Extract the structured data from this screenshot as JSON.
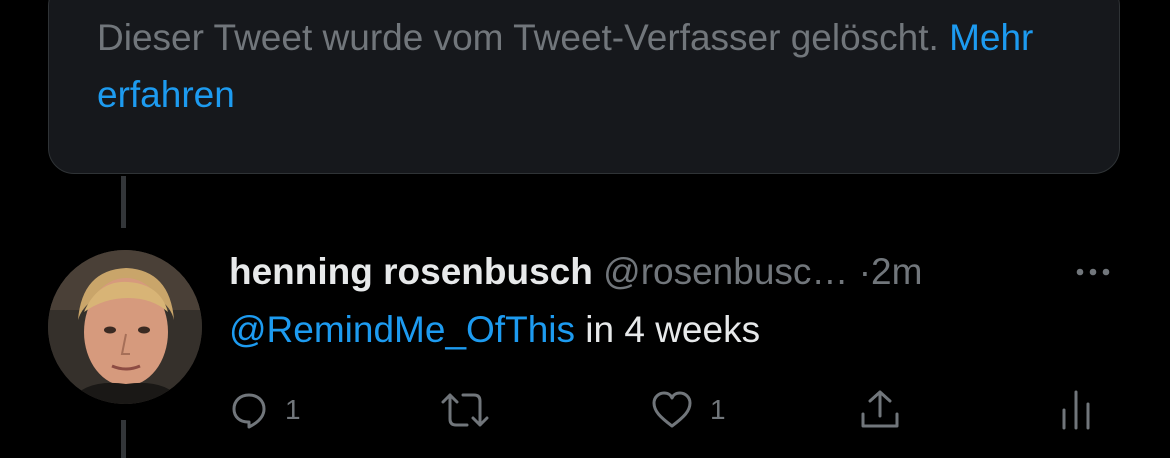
{
  "deleted_tweet": {
    "text": "Dieser Tweet wurde vom Tweet-Verfasser gelöscht.",
    "link": "Mehr erfahren"
  },
  "tweet": {
    "author_name": "henning rosenbusch",
    "handle": "@rosenbusc…",
    "separator": "·",
    "time": "2m",
    "mention": "@RemindMe_OfThis",
    "body": "in 4 weeks",
    "actions": {
      "replies": "1",
      "retweets": "",
      "likes": "1"
    }
  },
  "icons": [
    "more-icon",
    "reply-icon",
    "retweet-icon",
    "like-icon",
    "share-icon",
    "analytics-icon"
  ],
  "colors": {
    "background": "#000000",
    "card": "#16181c",
    "muted_text": "#71767b",
    "primary_text": "#e7e9ea",
    "link": "#1d9bf0"
  }
}
